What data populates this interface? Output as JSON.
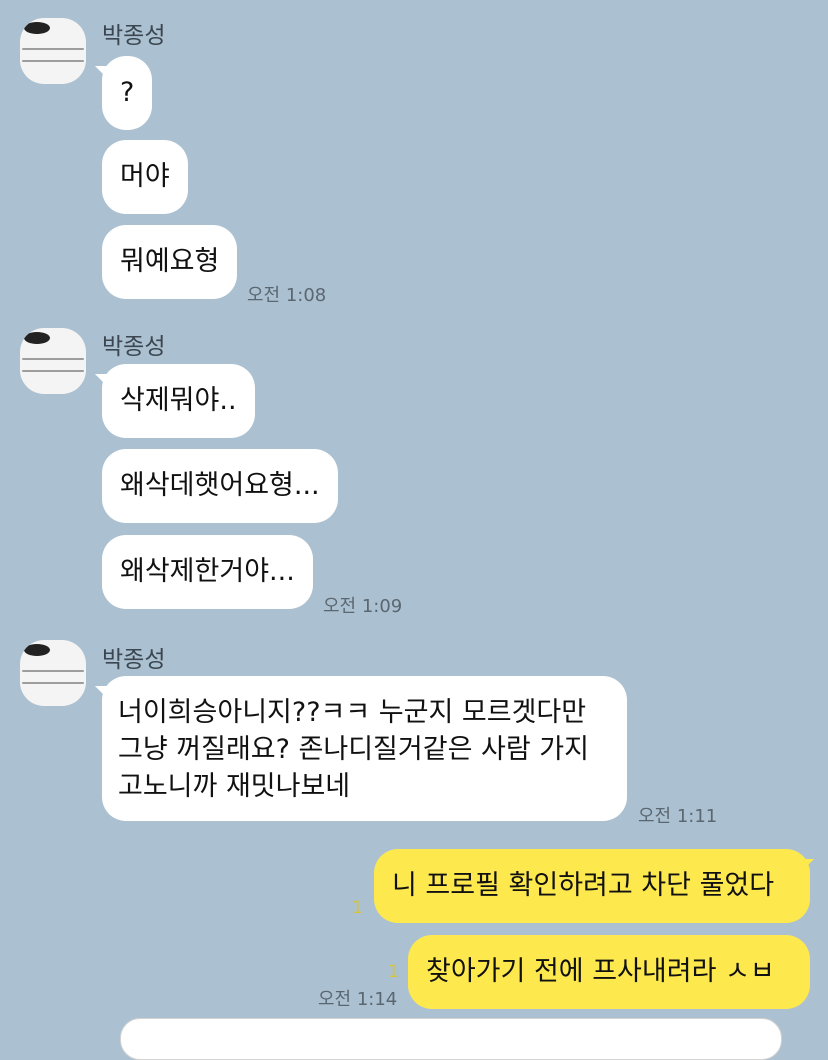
{
  "chat": {
    "groups": [
      {
        "sender": "박종성",
        "messages": [
          "?",
          "머야",
          "뭐예요형"
        ],
        "time": "오전 1:08"
      },
      {
        "sender": "박종성",
        "messages": [
          "삭제뭐야..",
          "왜삭데햇어요형...",
          "왜삭제한거야..."
        ],
        "time": "오전 1:09"
      },
      {
        "sender": "박종성",
        "messages": [
          "너이희승아니지??ㅋㅋ 누군지 모르겟다만 그냥 꺼질래요? 존나디질거같은 사람 가지고노니까 재밋나보네"
        ],
        "time": "오전 1:11"
      }
    ],
    "my_messages": [
      {
        "text": "니 프로필 확인하려고 차단 풀었다",
        "unread": "1"
      },
      {
        "text": "찾아가기 전에 프사내려라 ㅅㅂ",
        "unread": "1"
      }
    ],
    "my_time": "오전 1:14"
  },
  "colors": {
    "background": "#abc1d1",
    "incoming_bubble": "#ffffff",
    "outgoing_bubble": "#fde94e",
    "unread_count": "#d7c33a"
  },
  "icons": {
    "avatar": "profile-photo-avatar"
  }
}
